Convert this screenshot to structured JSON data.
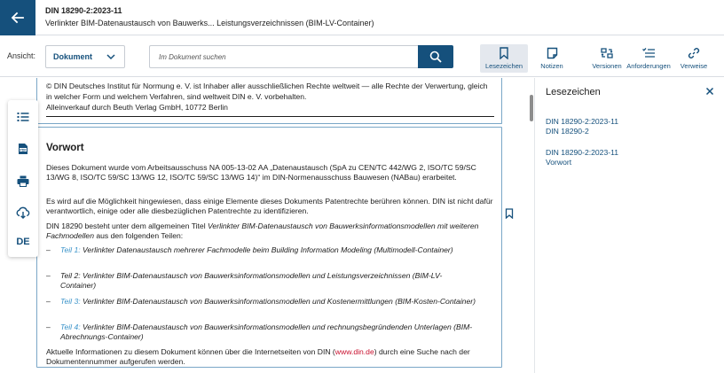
{
  "header": {
    "doc_code": "DIN 18290-2:2023-11",
    "doc_title": "Verlinkter BIM-Datenaustausch von Bauwerks... Leistungsverzeichnissen (BIM-LV-Container)"
  },
  "toolbar": {
    "view_label": "Ansicht:",
    "view_value": "Dokument",
    "search_placeholder": "Im Dokument suchen",
    "tools": [
      {
        "label": "Lesezeichen",
        "icon": "bookmark-icon",
        "active": true
      },
      {
        "label": "Notizen",
        "icon": "note-icon"
      },
      {
        "label": "Versionen",
        "icon": "versions-icon"
      },
      {
        "label": "Anforderungen",
        "icon": "requirements-icon"
      },
      {
        "label": "Verweise",
        "icon": "link-icon"
      }
    ]
  },
  "rail": {
    "items": [
      "toc-icon",
      "pdf-icon",
      "print-icon",
      "download-icon"
    ],
    "language": "DE"
  },
  "document": {
    "copyright": "© DIN Deutsches Institut für Normung e. V. ist Inhaber aller ausschließlichen Rechte weltweit — alle Rechte der Verwertung, gleich in welcher Form und welchem Verfahren, sind weltweit DIN e. V. vorbehalten.",
    "sales": "Alleinverkauf durch Beuth Verlag GmbH, 10772 Berlin",
    "section_title": "Vorwort",
    "p1": "Dieses Dokument wurde vom Arbeitsausschuss NA 005-13-02 AA „Datenaustausch (SpA zu CEN/TC 442/WG 2, ISO/TC 59/SC 13/WG 8, ISO/TC 59/SC 13/WG 12, ISO/TC 59/SC 13/WG 14)“ im DIN-Normenausschuss Bauwesen (NABau) erarbeitet.",
    "p2": "Es wird auf die Möglichkeit hingewiesen, dass einige Elemente dieses Dokuments Patentrechte berühren können. DIN ist nicht dafür verantwortlich, einige oder alle diesbezüglichen Patentrechte zu identifizieren.",
    "p3_start": "DIN 18290 besteht unter dem allgemeinen Titel ",
    "p3_italic": "Verlinkter BIM-Datenaustausch von Bauwerksinformationsmodellen mit weiteren Fachmodellen",
    "p3_end": " aus den folgenden Teilen:",
    "parts": [
      {
        "part": "Teil 1:",
        "text": " Verlinkter Datenaustausch mehrerer Fachmodelle beim Building Information Modeling (Multimodell-Container)",
        "linked": true
      },
      {
        "part": "Teil 2:",
        "text": " Verlinkter BIM-Datenaustausch von Bauwerksinformationsmodellen und Leistungsverzeichnissen (BIM-LV-Container)",
        "linked": false
      },
      {
        "part": "Teil 3:",
        "text": " Verlinkter BIM-Datenaustausch von Bauwerksinformationsmodellen und Kostenermittlungen (BIM-Kosten-Container)",
        "linked": true
      },
      {
        "part": "Teil 4:",
        "text": " Verlinkter BIM-Datenaustausch von Bauwerksinformationsmodellen und rechnungsbegründenden Unterlagen (BIM-Abrechnungs-Container)",
        "linked": true
      }
    ],
    "p4_start": "Aktuelle Informationen zu diesem Dokument können über die Internetseiten von DIN (",
    "p4_link": "www.din.de",
    "p4_end": ") durch eine Suche nach der Dokumentennummer aufgerufen werden."
  },
  "panel": {
    "title": "Lesezeichen",
    "bookmarks": [
      {
        "line1": "DIN 18290-2:2023-11",
        "line2": "DIN 18290-2"
      },
      {
        "line1": "DIN 18290-2:2023-11",
        "line2": "Vorwort"
      }
    ]
  },
  "colors": {
    "primary": "#15507c",
    "part_link": "#3a93c9",
    "external_link": "#c8102e",
    "box_border": "#7aa7c7"
  }
}
